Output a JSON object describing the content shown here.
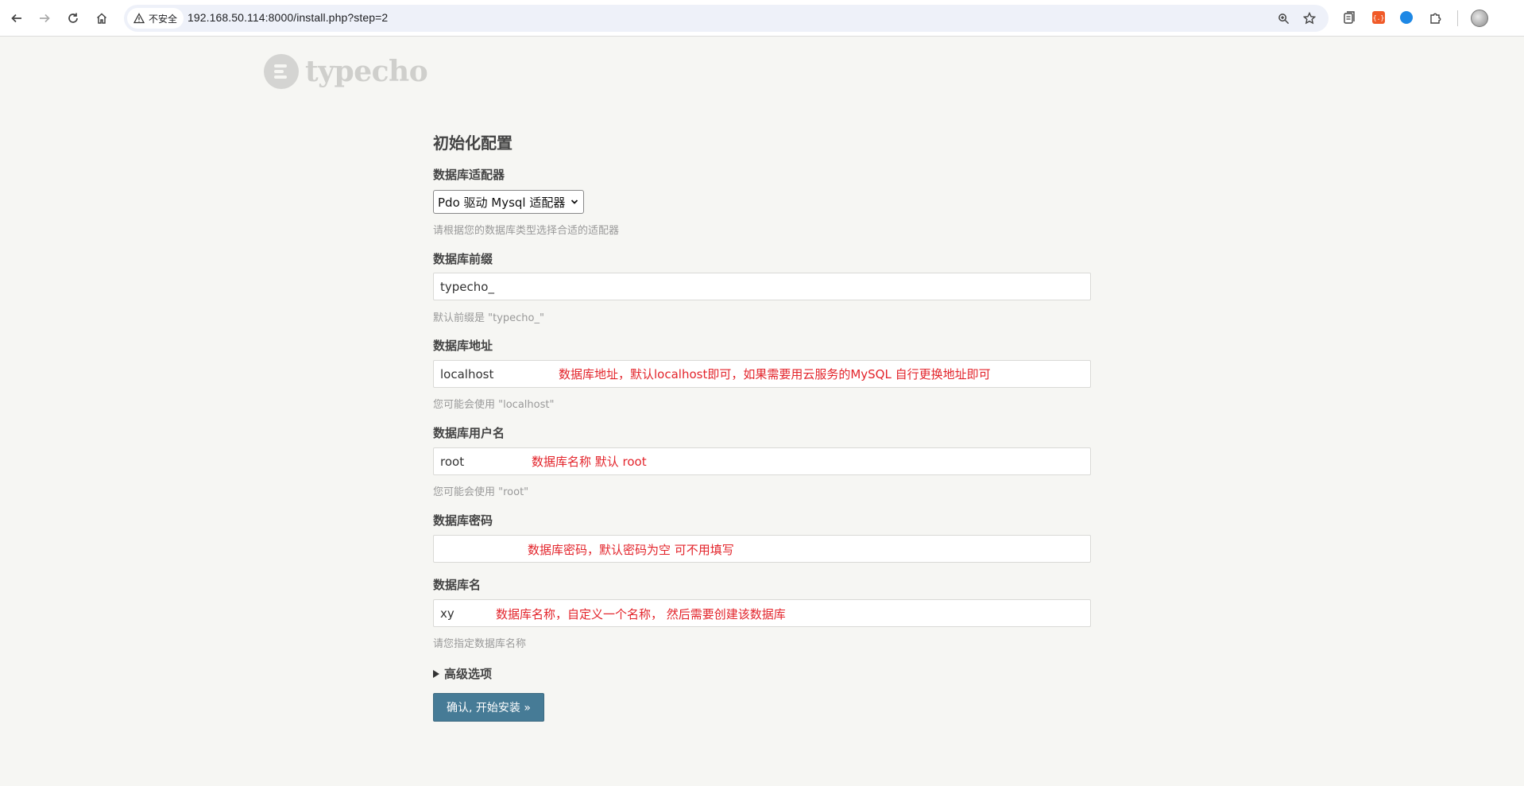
{
  "browser": {
    "security_label": "不安全",
    "url": "192.168.50.114:8000/install.php?step=2",
    "icons": [
      "back-icon",
      "forward-icon",
      "reload-icon",
      "home-icon",
      "warning-icon",
      "zoom-icon",
      "star-icon",
      "tab-search-icon",
      "extension-red-icon",
      "download-icon",
      "extensions-icon",
      "profile-avatar"
    ]
  },
  "logo": {
    "text": "typecho"
  },
  "form": {
    "title": "初始化配置",
    "adapter": {
      "label": "数据库适配器",
      "selected": "Pdo 驱动 Mysql 适配器",
      "description": "请根据您的数据库类型选择合适的适配器"
    },
    "prefix": {
      "label": "数据库前缀",
      "value": "typecho_",
      "description": "默认前缀是 \"typecho_\""
    },
    "host": {
      "label": "数据库地址",
      "value": "localhost",
      "annotation": "数据库地址，默认localhost即可，如果需要用云服务的MySQL 自行更换地址即可",
      "description": "您可能会使用 \"localhost\""
    },
    "user": {
      "label": "数据库用户名",
      "value": "root",
      "annotation": "数据库名称  默认 root",
      "description": "您可能会使用 \"root\""
    },
    "password": {
      "label": "数据库密码",
      "value": "",
      "annotation": "数据库密码，默认密码为空  可不用填写"
    },
    "dbname": {
      "label": "数据库名",
      "value": "xy",
      "annotation": "数据库名称，自定义一个名称，  然后需要创建该数据库",
      "description": "请您指定数据库名称"
    },
    "advanced_label": "高级选项",
    "submit_label": "确认, 开始安装 »"
  },
  "colors": {
    "button": "#467b96",
    "annotation": "#e3242b",
    "page_bg": "#f6f6f3"
  }
}
